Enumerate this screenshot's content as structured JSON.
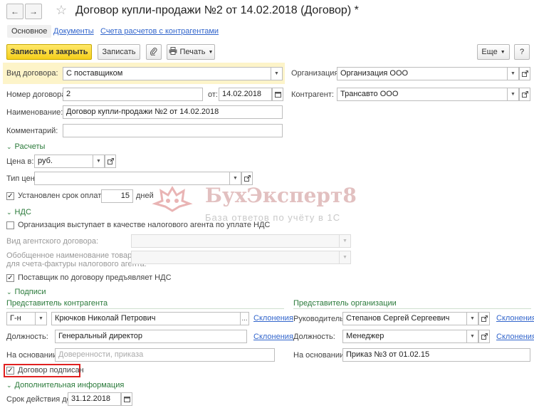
{
  "header": {
    "back_icon": "arrow-left-icon",
    "forward_icon": "arrow-right-icon",
    "star_icon": "star-icon",
    "title": "Договор купли-продажи №2 от 14.02.2018 (Договор) *"
  },
  "tabs": [
    {
      "label": "Основное"
    },
    {
      "label": "Документы"
    },
    {
      "label": "Счета расчетов с контрагентами"
    }
  ],
  "toolbar": {
    "save_close": "Записать и закрыть",
    "save": "Записать",
    "print": "Печать",
    "more": "Еще",
    "help": "?"
  },
  "form": {
    "contract_type_label": "Вид договора:",
    "contract_type_value": "С поставщиком",
    "org_label": "Организация:",
    "org_value": "Организация ООО",
    "number_label": "Номер договора:",
    "number_value": "2",
    "date_label": "от:",
    "date_value": "14.02.2018",
    "counterparty_label": "Контрагент:",
    "counterparty_value": "Трансавто ООО",
    "name_label": "Наименование:",
    "name_value": "Договор купли-продажи №2 от 14.02.2018",
    "comment_label": "Комментарий:",
    "comment_value": ""
  },
  "settlements": {
    "section": "Расчеты",
    "price_in_label": "Цена в:",
    "price_in_value": "руб.",
    "price_type_label": "Тип цен:",
    "price_type_value": "",
    "payment_term_label": "Установлен срок оплаты",
    "payment_term_checked": true,
    "payment_days": "15",
    "days_label": "дней"
  },
  "vat": {
    "section": "НДС",
    "tax_agent_label": "Организация выступает в качестве налогового агента по уплате НДС",
    "tax_agent_checked": false,
    "agent_contract_label": "Вид агентского договора:",
    "generalized_name_label_1": "Обобщенное наименование товаров",
    "generalized_name_label_2": "для счета-фактуры налогового агента:",
    "supplier_vat_label": "Поставщик по договору предъявляет НДС",
    "supplier_vat_checked": true
  },
  "signatures": {
    "section": "Подписи",
    "cp_rep_title": "Представитель контрагента",
    "salutation_value": "Г-н",
    "cp_person_value": "Крючков Николай Петрович",
    "ellipsis": "...",
    "declension": "Склонения",
    "position_label": "Должность:",
    "cp_position_value": "Генеральный директор",
    "basis_label": "На основании:",
    "cp_basis_placeholder": "Доверенности, приказа",
    "org_rep_title": "Представитель организации",
    "head_label": "Руководитель:",
    "org_person_value": "Степанов Сергей Сергеевич",
    "org_position_value": "Менеджер",
    "org_basis_value": "Приказ №3 от 01.02.15",
    "signed_label": "Договор подписан",
    "signed_checked": true
  },
  "additional": {
    "section": "Дополнительная информация",
    "valid_until_label": "Срок действия до:",
    "valid_until_value": "31.12.2018"
  },
  "watermark": {
    "title": "БухЭксперт8",
    "subtitle": "База ответов по учёту в 1С"
  },
  "colors": {
    "accent_green": "#2a7a3a",
    "link_blue": "#3366cc",
    "primary_yellow": "#f5cf1a",
    "highlight_red": "#e02020"
  }
}
